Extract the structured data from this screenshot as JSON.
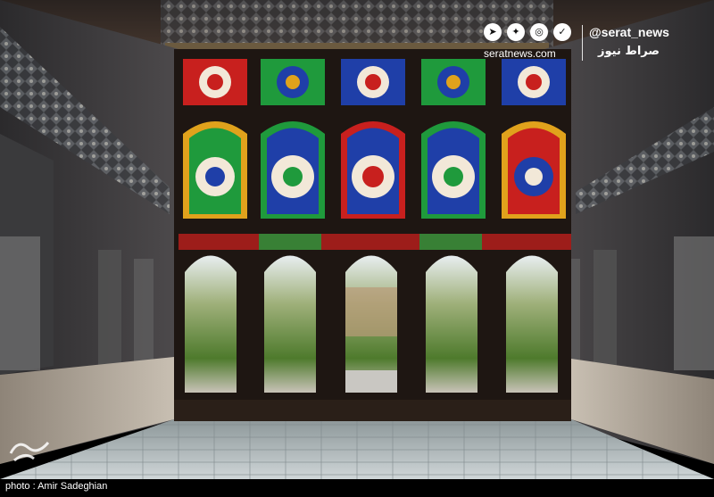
{
  "watermark": {
    "handle": "@serat_news",
    "site": "seratnews.com",
    "persian_name": "صراط نیوز",
    "social_icons": [
      "telegram-icon",
      "twitter-icon",
      "instagram-icon",
      "soroush-icon"
    ]
  },
  "credit": {
    "text": "photo : Amir Sadeghian"
  },
  "colors": {
    "glass_red": "#c8201e",
    "glass_blue": "#1f3fa8",
    "glass_green": "#1f9a3c",
    "glass_gold": "#e0a21c",
    "frame_dark": "#1e1612",
    "floor": "#b9c2c5"
  }
}
